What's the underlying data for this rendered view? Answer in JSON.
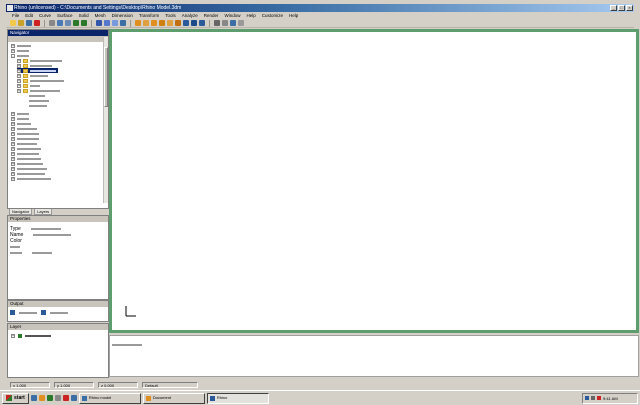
{
  "window": {
    "title": "Rhino (unlicensed) - C:\\Documents and Settings\\Desktop\\Rhino Model.3dm",
    "controls": [
      "minimize",
      "maximize",
      "close"
    ]
  },
  "menu": [
    "File",
    "Edit",
    "Curve",
    "Surface",
    "Solid",
    "Mesh",
    "Dimension",
    "Transform",
    "Tools",
    "Analyze",
    "Render",
    "Window",
    "Help",
    "Customize",
    "Help"
  ],
  "toolbar": {
    "icons": [
      "new-icon",
      "open-icon",
      "save-icon",
      "print-icon",
      "cut-icon",
      "copy-icon",
      "paste-icon",
      "undo-icon",
      "redo-icon",
      "select-icon",
      "zoom-icon",
      "pan-icon",
      "rotate-icon",
      "point-icon",
      "line-icon",
      "arc-icon",
      "circle-icon",
      "rectangle-icon",
      "curve-icon",
      "surface-icon",
      "solid-icon",
      "mesh-icon",
      "transform-icon",
      "layer-icon",
      "render-icon",
      "help-icon"
    ]
  },
  "navigator": {
    "title": "Navigator",
    "tabs": [
      "Navigator",
      "Layers"
    ]
  },
  "properties": {
    "title": "Properties",
    "rows": [
      {
        "key": "Type",
        "value": ""
      },
      {
        "key": "Name",
        "value": ""
      },
      {
        "key": "Color",
        "value": ""
      }
    ]
  },
  "output_panel": {
    "title": "Output"
  },
  "layers_panel": {
    "title": "Layer",
    "item": "Default"
  },
  "status": {
    "fields": [
      "x 1.000",
      "y 1.000",
      "z 0.000",
      "Default"
    ]
  },
  "taskbar": {
    "start": "start",
    "tasks": [
      "Rhino model",
      "Document",
      "Rhino"
    ],
    "clock": "9:41 AM"
  },
  "colors": {
    "viewport_border": "#5e9e6e",
    "selection": "#0a246a",
    "titlebar": "#0a246a"
  }
}
